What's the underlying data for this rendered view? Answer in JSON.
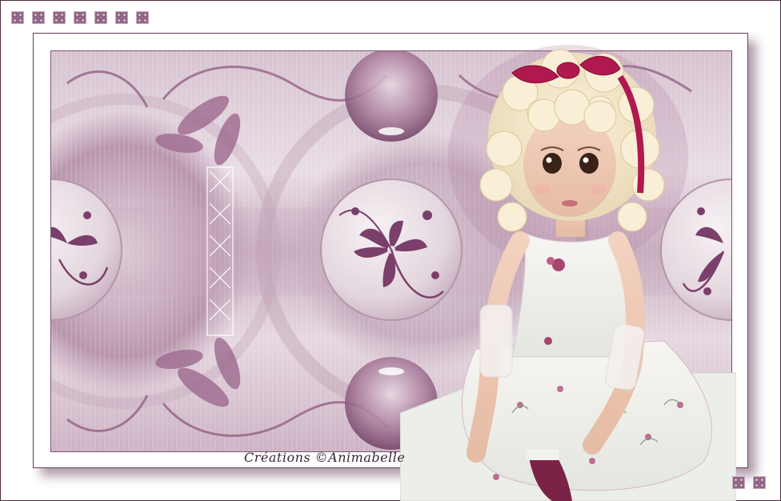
{
  "artwork": {
    "signature": "Créations ©Animabelle",
    "subject_icon": "doll-figure",
    "ornament_icon": "flower-medallion",
    "corner_icon": "knot-square-icon"
  },
  "decor": {
    "top_count": 7,
    "bottom_count": 2
  },
  "colors": {
    "mauve_dark": "#7b3f6b",
    "mauve_mid": "#b48aa6",
    "mauve_light": "#e6d8e1",
    "ribbon": "#b0194f",
    "frame": "#6a3f5e"
  }
}
